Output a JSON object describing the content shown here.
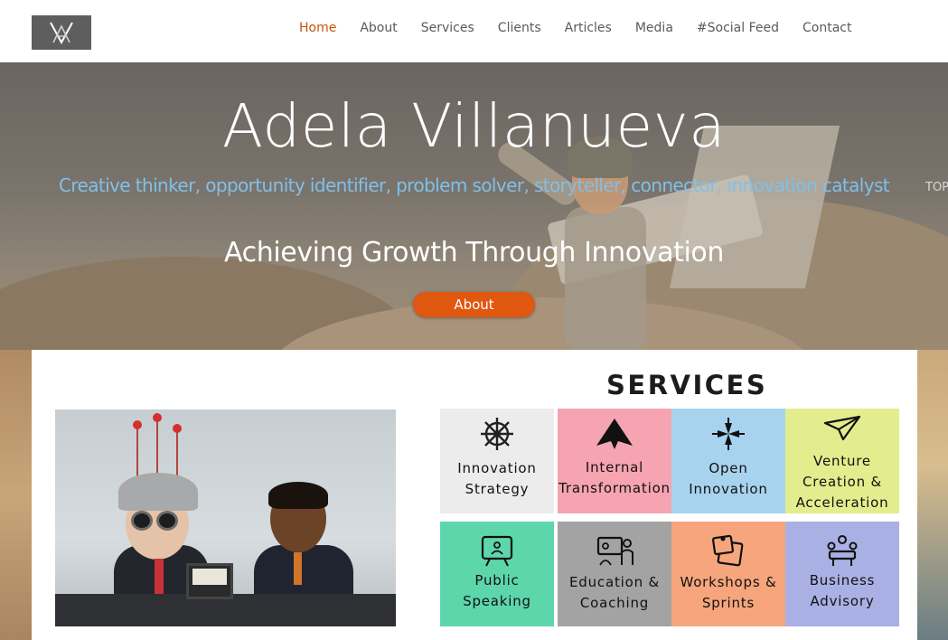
{
  "header": {
    "logo_icon": "va-monogram-logo",
    "nav": [
      {
        "label": "Home",
        "active": true
      },
      {
        "label": "About"
      },
      {
        "label": "Services"
      },
      {
        "label": "Clients"
      },
      {
        "label": "Articles"
      },
      {
        "label": "Media"
      },
      {
        "label": "#Social Feed"
      },
      {
        "label": "Contact"
      }
    ]
  },
  "hero": {
    "title": "Adela Villanueva",
    "tagline": "Creative thinker, opportunity identifier, problem solver, storyteller, connector, innovation catalyst",
    "top_label": "TOP",
    "subtitle": "Achieving Growth Through Innovation",
    "button_label": "About"
  },
  "colors": {
    "accent": "#e0570f",
    "nav_active": "#c8520c",
    "tagline": "#7fc0ea"
  },
  "services": {
    "title": "SERVICES",
    "tiles": [
      {
        "icon": "ship-wheel-icon",
        "line1": "Innovation",
        "line2": "Strategy",
        "color": "#ececec"
      },
      {
        "icon": "arrow-mountain-icon",
        "line1": "Internal",
        "line2": "Transformation",
        "color": "#f6a4b1"
      },
      {
        "icon": "converging-arrows-icon",
        "line1": "Open",
        "line2": "Innovation",
        "color": "#a8d3ef"
      },
      {
        "icon": "paper-plane-icon",
        "line1": "Venture",
        "line2": "Creation &",
        "line3": "Acceleration",
        "color": "#e3ed8e"
      },
      {
        "icon": "presentation-screen-icon",
        "line1": "Public",
        "line2": "Speaking",
        "color": "#5dd6ac"
      },
      {
        "icon": "teaching-board-icon",
        "line1": "Education &",
        "line2": "Coaching",
        "color": "#a3a3a3"
      },
      {
        "icon": "sticky-notes-icon",
        "line1": "Workshops &",
        "line2": "Sprints",
        "color": "#f6a57d"
      },
      {
        "icon": "meeting-table-icon",
        "line1": "Business",
        "line2": "Advisory",
        "color": "#a9b0e4"
      }
    ]
  }
}
